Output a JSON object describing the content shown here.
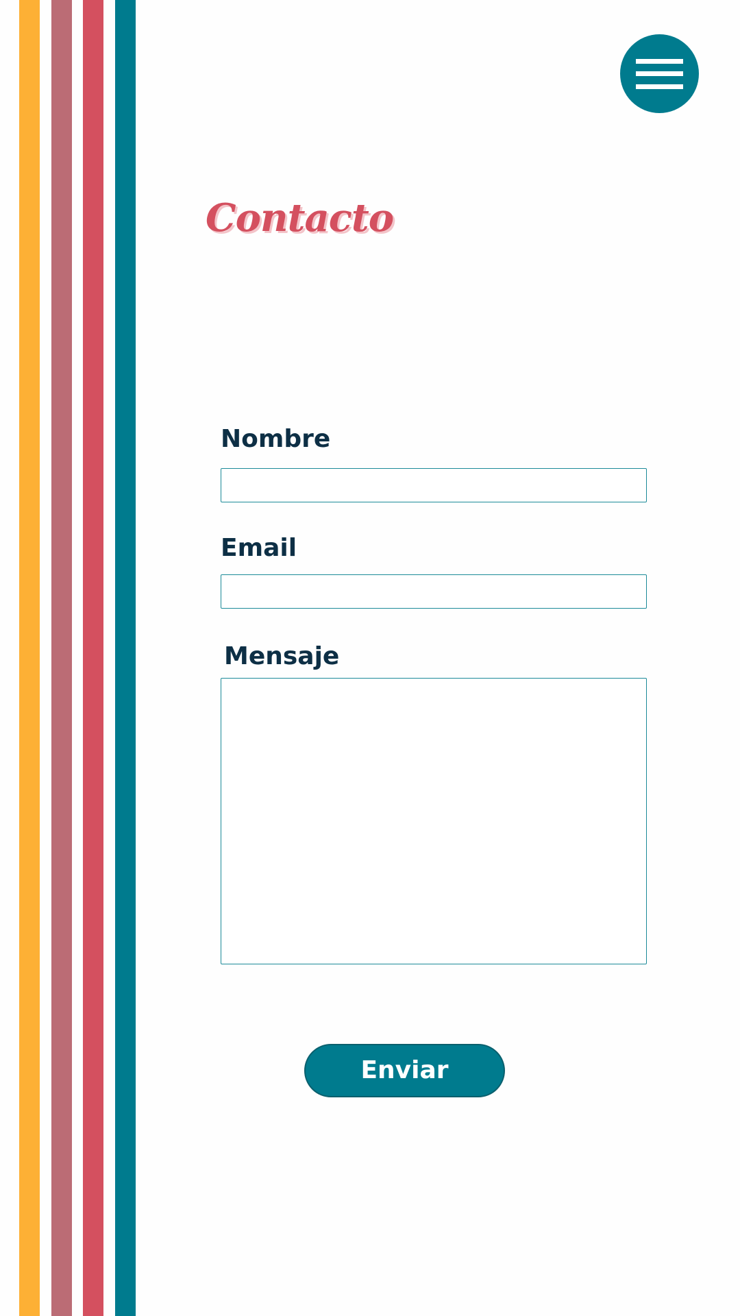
{
  "header": {
    "menu_icon": "hamburger-menu-icon"
  },
  "page": {
    "title": "Contacto"
  },
  "form": {
    "name_label": "Nombre",
    "name_value": "",
    "email_label": "Email",
    "email_value": "",
    "message_label": "Mensaje",
    "message_value": "",
    "submit_label": "Enviar"
  },
  "colors": {
    "background": "#fefefe",
    "stripe_yellow": "#fdb035",
    "stripe_mauve": "#bb6c75",
    "stripe_red": "#d4505f",
    "stripe_teal": "#007b8e",
    "title": "#d4505f",
    "label_text": "#0d2f45",
    "accent": "#007b8e"
  }
}
